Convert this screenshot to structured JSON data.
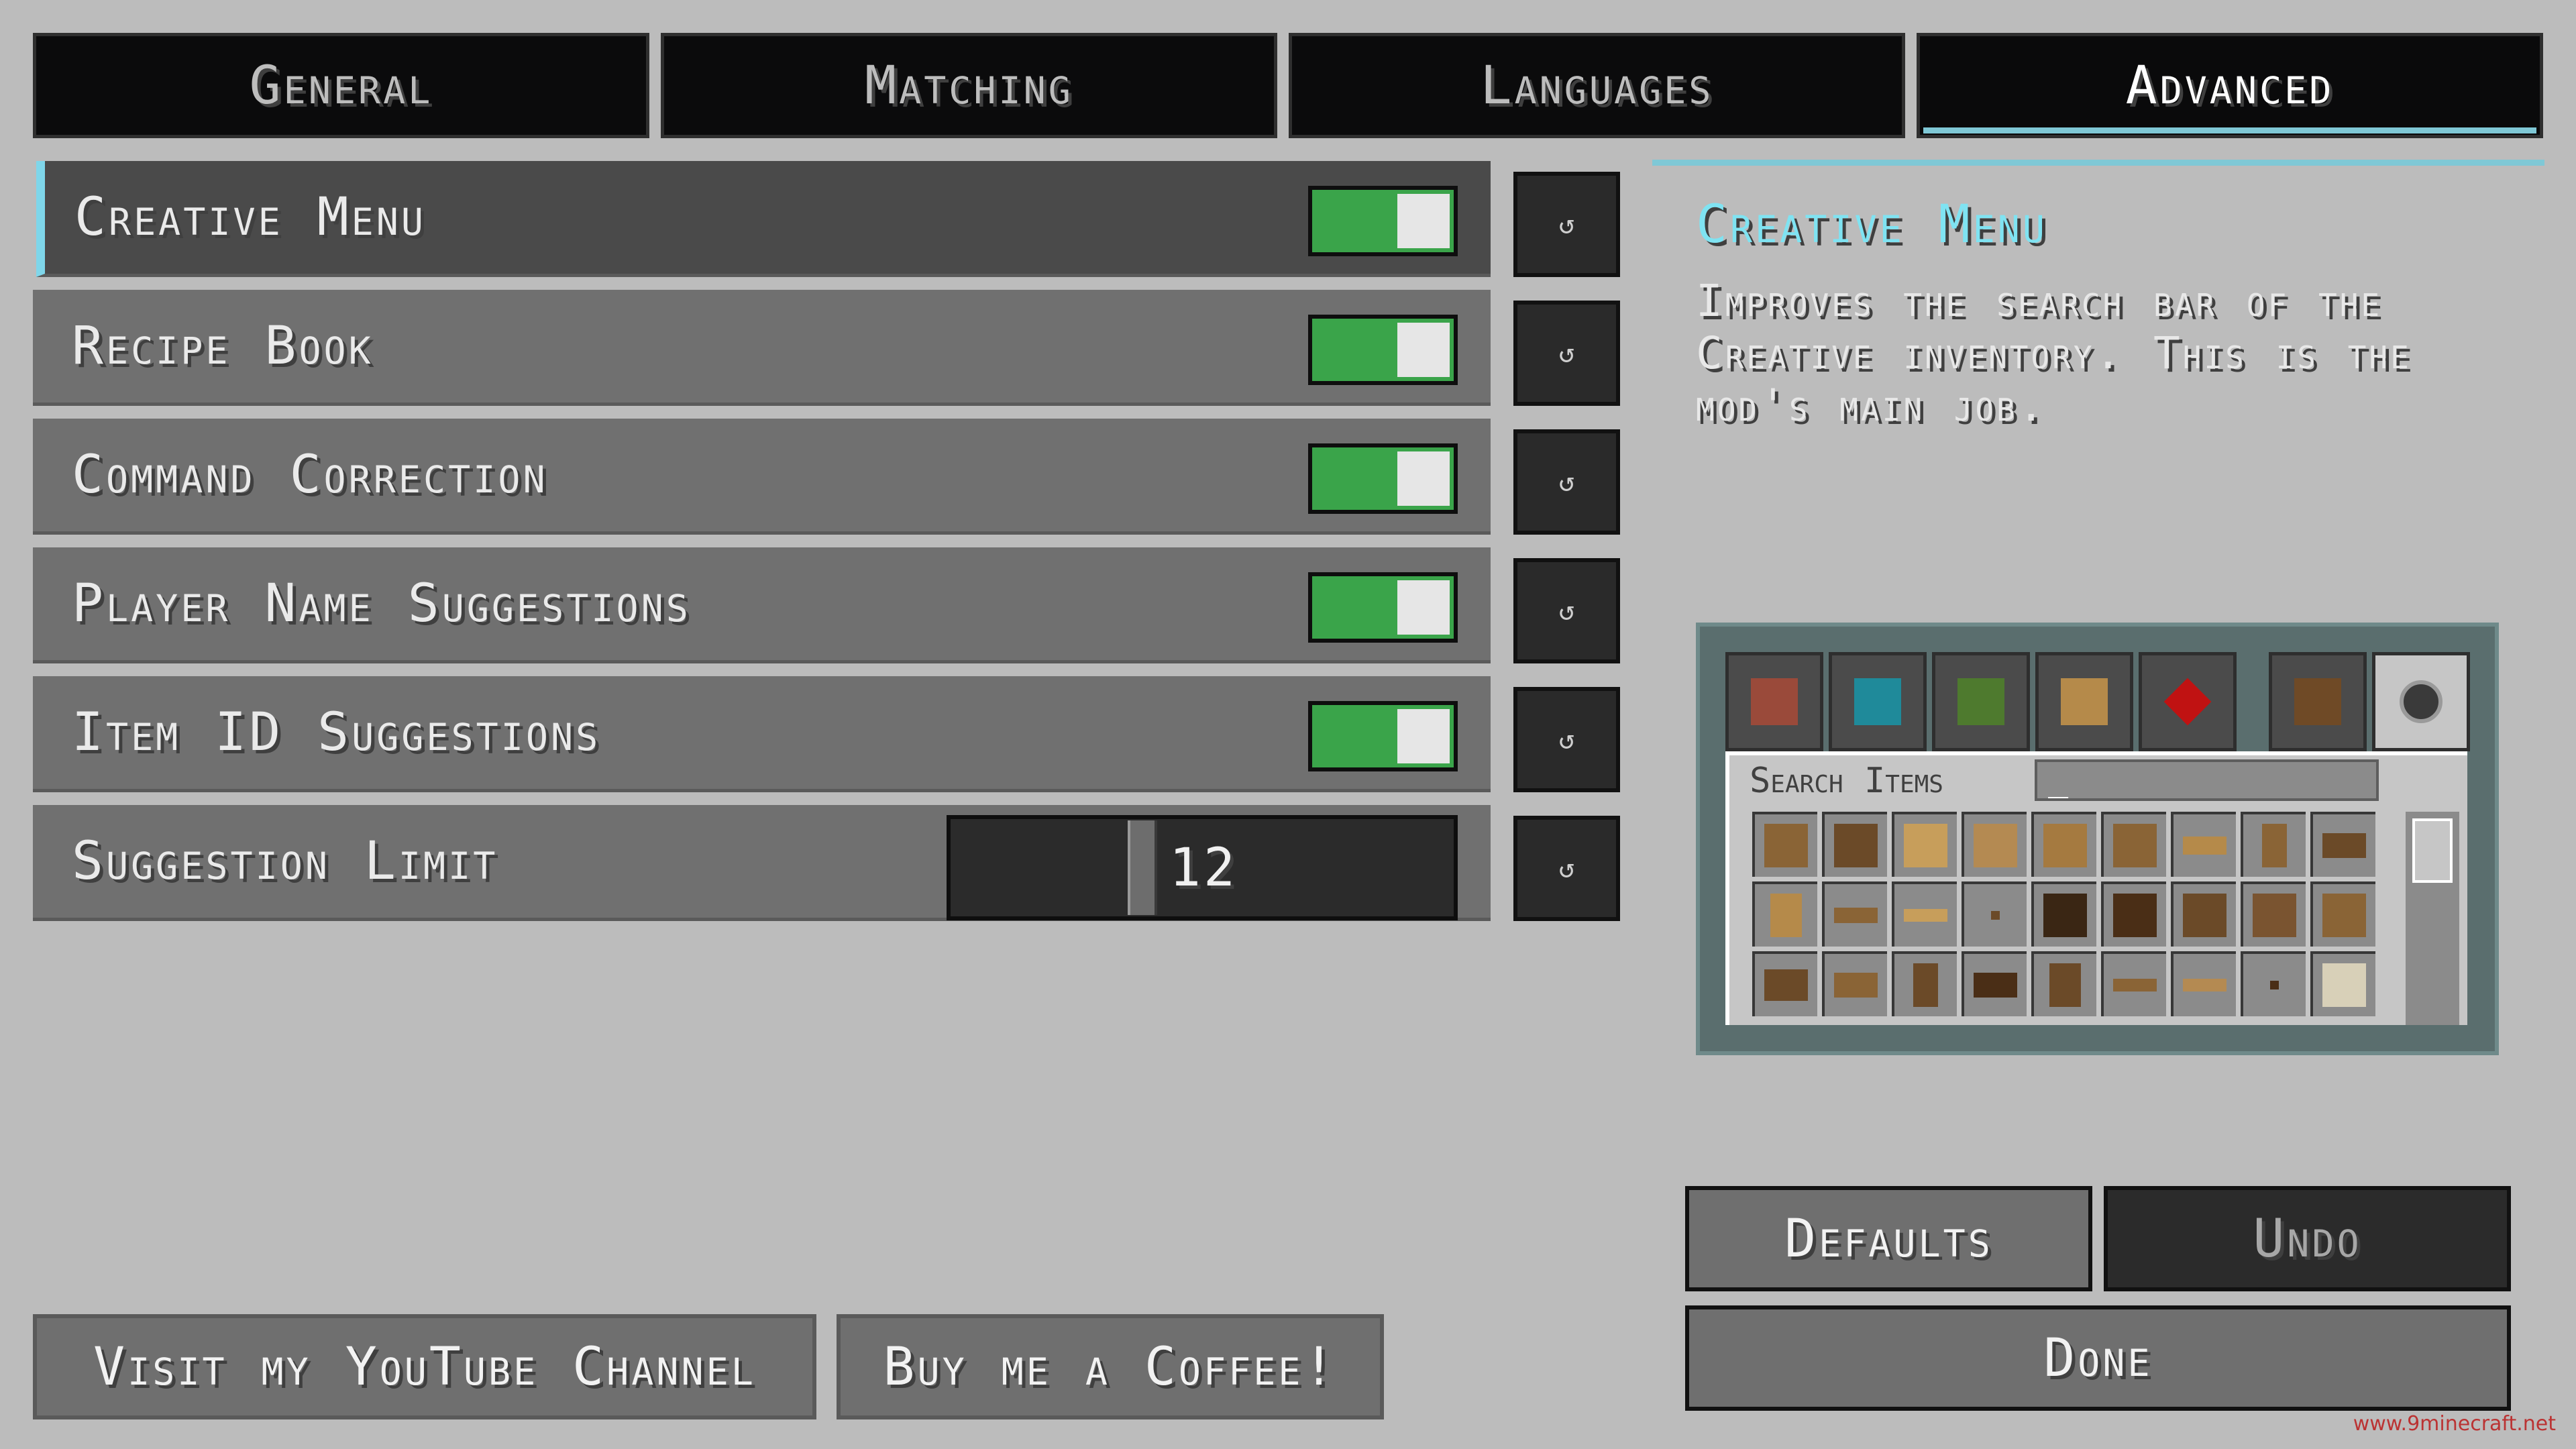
{
  "tabs": [
    {
      "label": "General",
      "active": false
    },
    {
      "label": "Matching",
      "active": false
    },
    {
      "label": "Languages",
      "active": false
    },
    {
      "label": "Advanced",
      "active": true
    }
  ],
  "options": [
    {
      "label": "Creative Menu",
      "type": "toggle",
      "value": true,
      "selected": true
    },
    {
      "label": "Recipe Book",
      "type": "toggle",
      "value": true
    },
    {
      "label": "Command Correction",
      "type": "toggle",
      "value": true
    },
    {
      "label": "Player Name Suggestions",
      "type": "toggle",
      "value": true
    },
    {
      "label": "Item ID Suggestions",
      "type": "toggle",
      "value": true
    },
    {
      "label": "Suggestion Limit",
      "type": "slider",
      "value": "12"
    }
  ],
  "reset_glyph": "↺",
  "info": {
    "title": "Creative Menu",
    "description": "Improves the search bar of the Creative inventory. This is the mod's main job."
  },
  "preview": {
    "search_label": "Search Items",
    "search_value": "_"
  },
  "buttons": {
    "defaults": "Defaults",
    "undo": "Undo",
    "done": "Done",
    "youtube": "Visit my YouTube Channel",
    "coffee": "Buy me a Coffee!"
  },
  "credit": "www.9minecraft.net",
  "colors": {
    "toggle_on": "#3aa44a",
    "accent": "#7fc8d6",
    "title": "#7fe3f2"
  }
}
